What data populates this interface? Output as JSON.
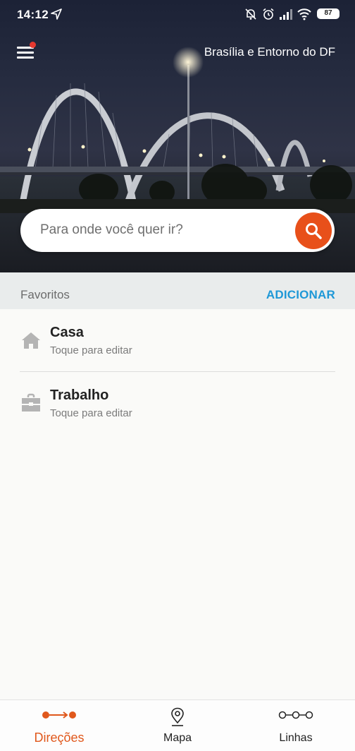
{
  "status": {
    "time": "14:12",
    "battery": "87"
  },
  "header": {
    "region": "Brasília e Entorno do DF",
    "menu_icon": "hamburger-menu-icon",
    "notification_dot_color": "#e5382f"
  },
  "search": {
    "placeholder": "Para onde você quer ir?",
    "button_icon": "search-icon",
    "button_color": "#e8501a"
  },
  "favorites": {
    "title": "Favoritos",
    "add_label": "ADICIONAR",
    "items": [
      {
        "icon": "home-icon",
        "name": "Casa",
        "subtitle": "Toque para editar"
      },
      {
        "icon": "briefcase-icon",
        "name": "Trabalho",
        "subtitle": "Toque para editar"
      }
    ]
  },
  "bottom_nav": {
    "tabs": [
      {
        "icon": "directions-icon",
        "label": "Direções",
        "active": true
      },
      {
        "icon": "map-pin-icon",
        "label": "Mapa",
        "active": false
      },
      {
        "icon": "lines-icon",
        "label": "Linhas",
        "active": false
      }
    ]
  },
  "colors": {
    "accent": "#e0581c",
    "link": "#1e98d7"
  }
}
